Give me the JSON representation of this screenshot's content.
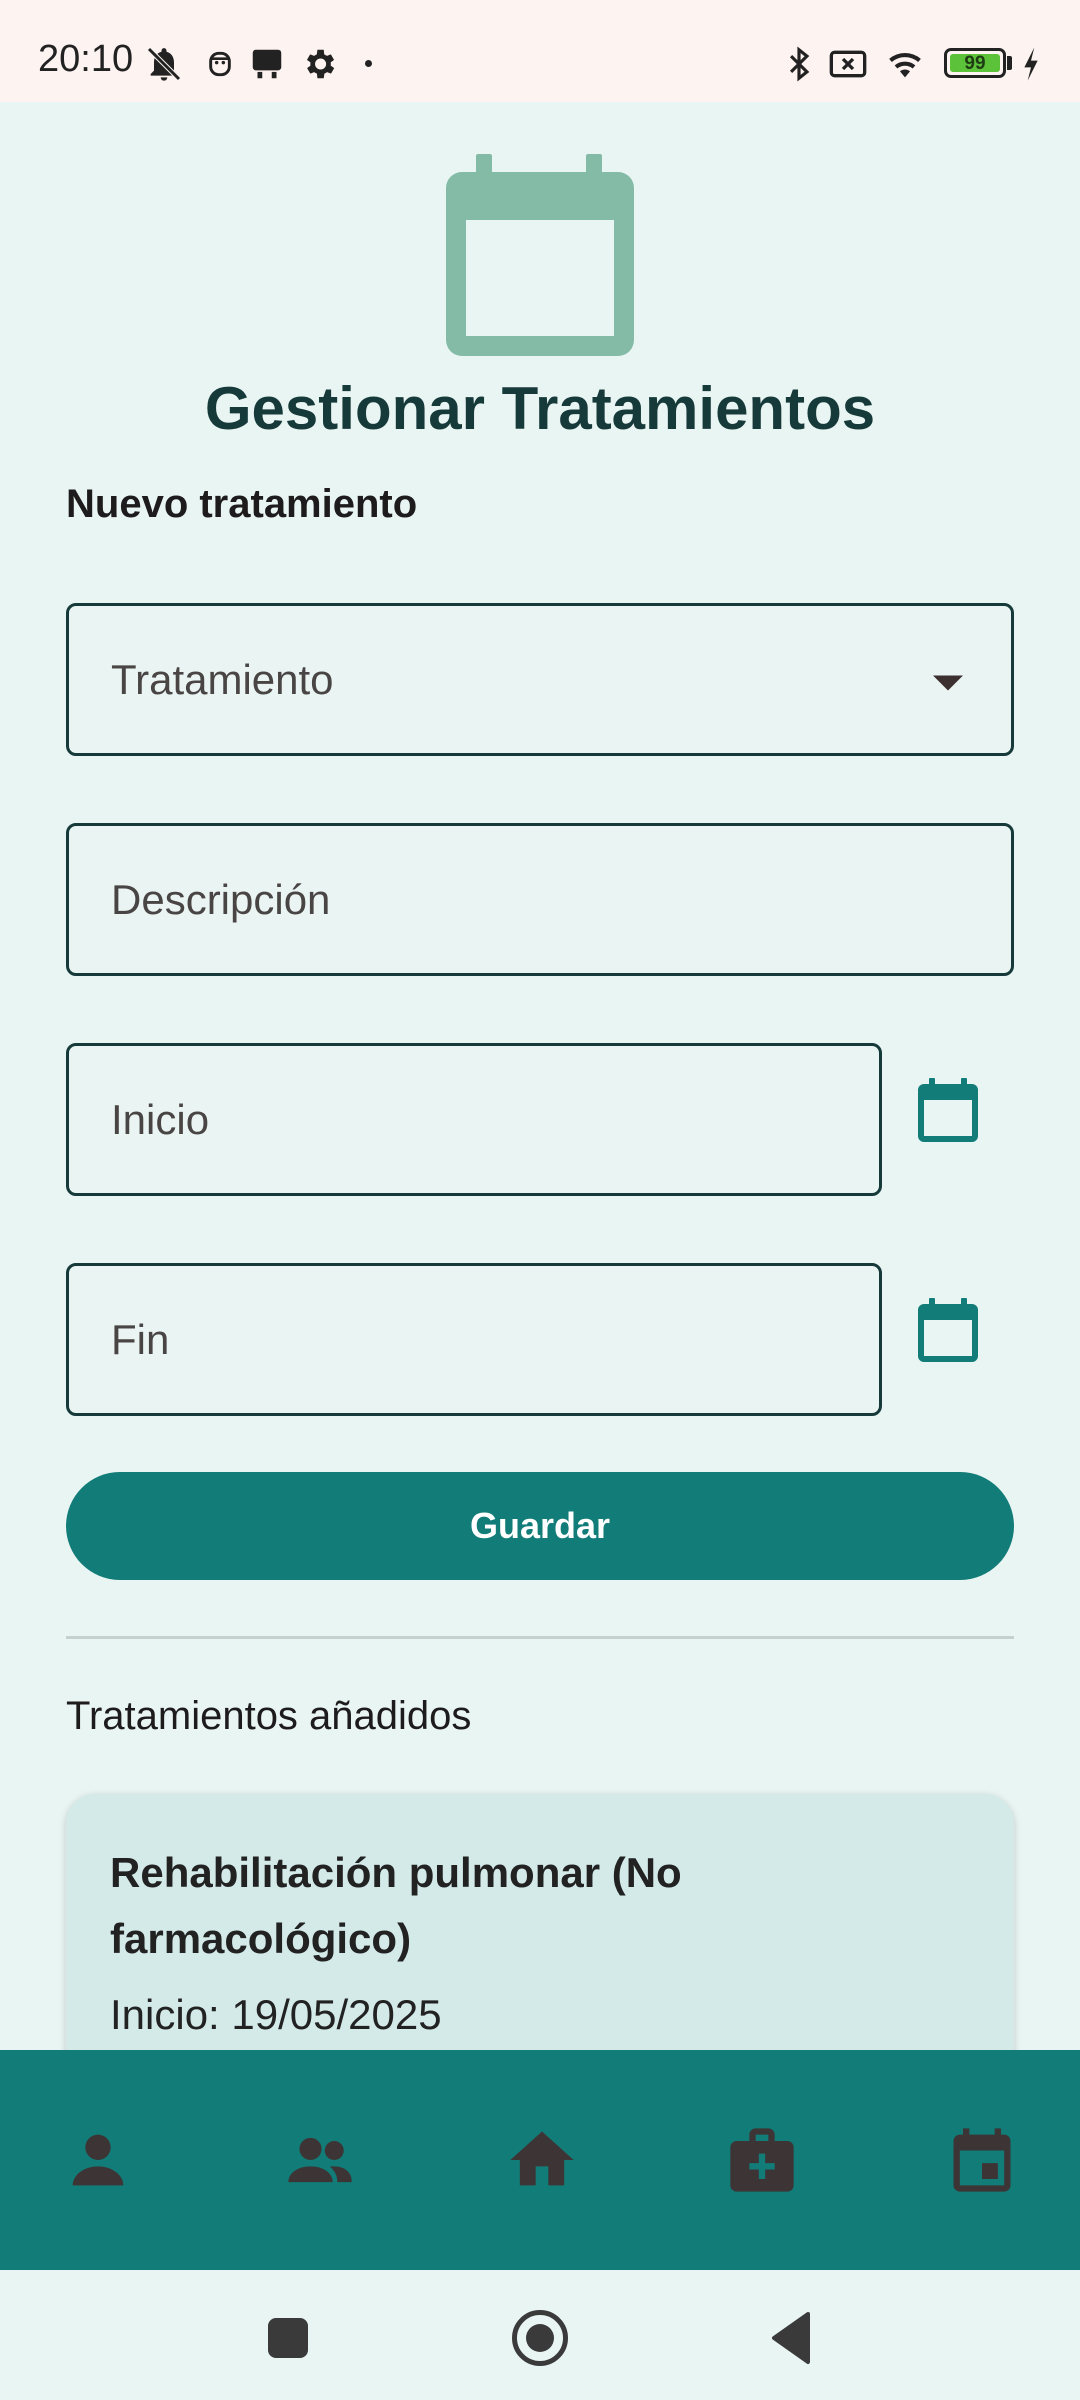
{
  "status_bar": {
    "time": "20:10",
    "battery": "99",
    "left_icons": [
      "mute-icon",
      "face-icon",
      "keyboard-icon",
      "settings-icon",
      "dot-icon"
    ],
    "right_icons": [
      "bluetooth-icon",
      "no-sim-icon",
      "wifi-icon",
      "battery-icon",
      "charging-icon"
    ]
  },
  "header": {
    "icon": "calendar-icon",
    "title": "Gestionar Tratamientos"
  },
  "form": {
    "section_title": "Nuevo tratamiento",
    "treatment_placeholder": "Tratamiento",
    "description_placeholder": "Descripción",
    "start_placeholder": "Inicio",
    "end_placeholder": "Fin",
    "save_label": "Guardar"
  },
  "list": {
    "section_title": "Tratamientos añadidos",
    "items": [
      {
        "title": "Rehabilitación pulmonar (No farmacológico)",
        "start": "Inicio: 19/05/2025"
      }
    ]
  },
  "bottom_nav": {
    "items": [
      {
        "icon": "person-icon"
      },
      {
        "icon": "group-icon"
      },
      {
        "icon": "home-icon"
      },
      {
        "icon": "medical-kit-icon"
      },
      {
        "icon": "calendar-event-icon"
      }
    ]
  },
  "colors": {
    "background": "#e9f5f3",
    "primary": "#127c78",
    "title": "#163a3a",
    "header_icon": "#84bba6",
    "card": "#d3eae9",
    "nav_icon": "#3d3535"
  }
}
